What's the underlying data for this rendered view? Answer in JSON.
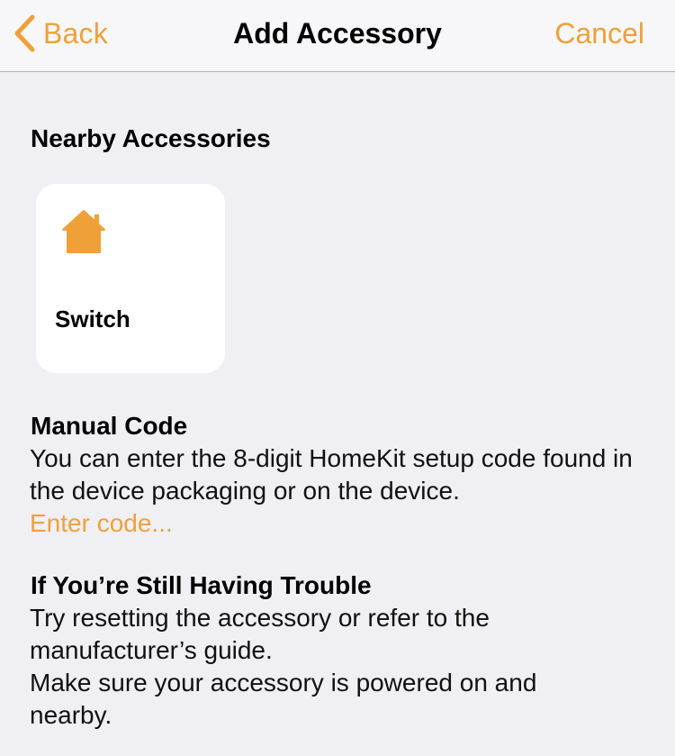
{
  "navbar": {
    "back_label": "Back",
    "title": "Add Accessory",
    "cancel_label": "Cancel"
  },
  "nearby": {
    "heading": "Nearby Accessories",
    "items": [
      {
        "label": "Switch",
        "icon": "house-icon"
      }
    ]
  },
  "manual": {
    "heading": "Manual Code",
    "description": "You can enter the 8-digit HomeKit setup code found in the device packaging or on the device.",
    "link_label": "Enter code..."
  },
  "trouble": {
    "heading": "If You’re Still Having Trouble",
    "line1": "Try resetting the accessory or refer to the manufacturer’s guide.",
    "line2": "Make sure your accessory is powered on and nearby."
  },
  "colors": {
    "accent": "#f0a039",
    "background": "#efeff4",
    "tile_background": "#ffffff"
  }
}
